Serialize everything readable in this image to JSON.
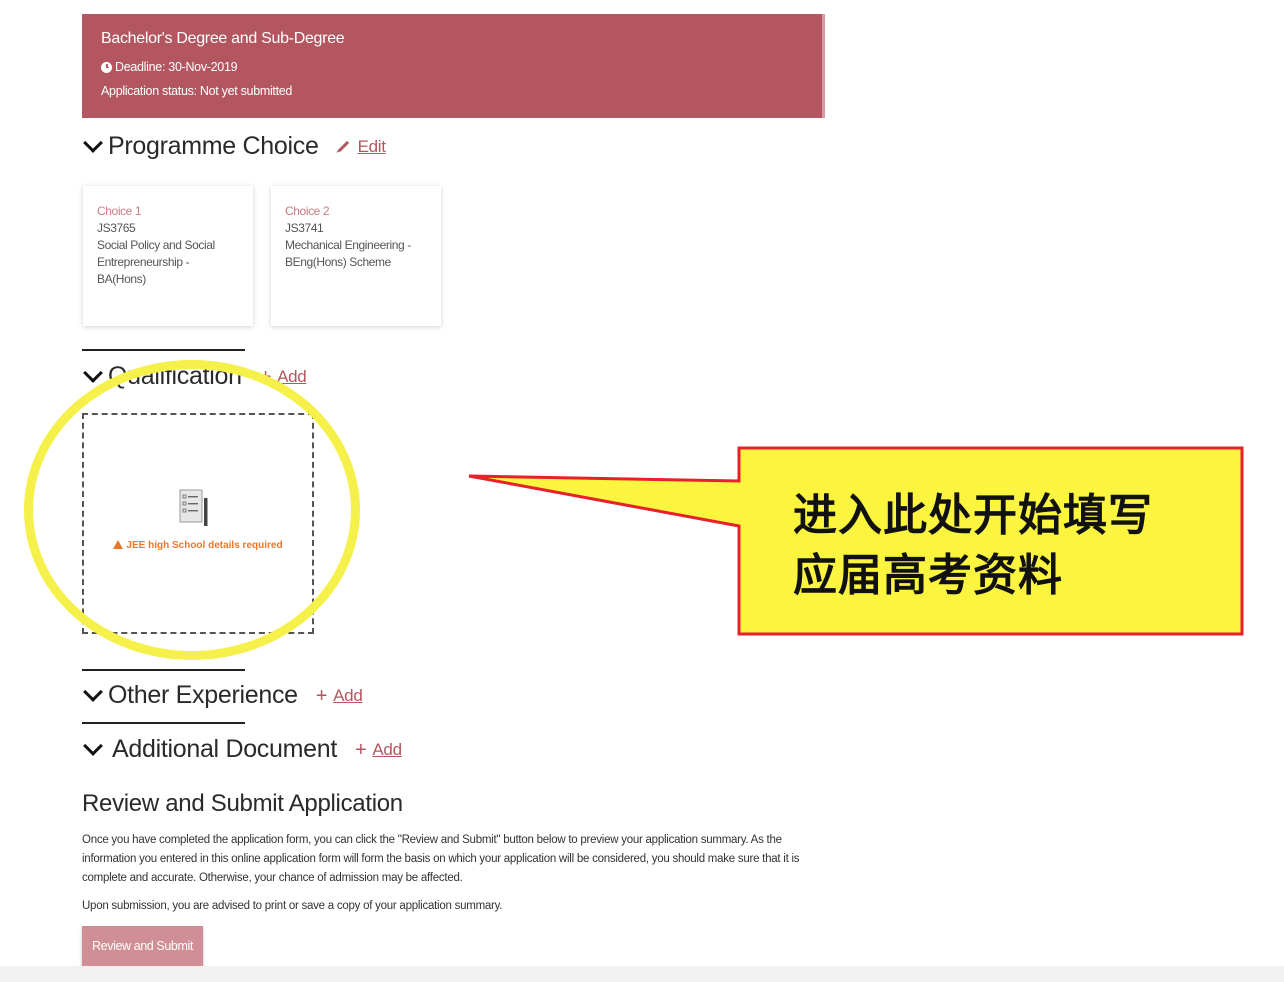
{
  "banner": {
    "title": "Bachelor's Degree and Sub-Degree",
    "deadline": "Deadline: 30-Nov-2019",
    "status": "Application status: Not yet submitted"
  },
  "programme": {
    "heading": "Programme Choice",
    "action": "Edit",
    "choices": [
      {
        "label": "Choice 1",
        "code": "JS3765",
        "name": "Social Policy and Social Entrepreneurship - BA(Hons)"
      },
      {
        "label": "Choice 2",
        "code": "JS3741",
        "name": "Mechanical Engineering - BEng(Hons) Scheme"
      }
    ]
  },
  "qualification": {
    "heading": "Qualification",
    "action": "Add",
    "warning": "JEE high School details required"
  },
  "other_experience": {
    "heading": "Other Experience",
    "action": "Add"
  },
  "additional_document": {
    "heading": "Additional Document",
    "action": "Add"
  },
  "review": {
    "title": "Review and Submit Application",
    "paragraph1": "Once you have completed the application form, you can click the \"Review and Submit\" button below to preview your application summary. As the information you entered in this online application form will form the basis on which your application will be considered, you should make sure that it is complete and accurate. Otherwise, your chance of admission may be affected.",
    "paragraph2": "Upon submission, you are advised to print or save a copy of your application summary.",
    "button": "Review and Submit"
  },
  "annotation": {
    "line1": "进入此处开始填写",
    "line2": "应届高考资料"
  },
  "colors": {
    "brand": "#b4565f",
    "warning": "#e8782a",
    "highlight": "#f6f04a",
    "callout_border": "#e8202a"
  }
}
